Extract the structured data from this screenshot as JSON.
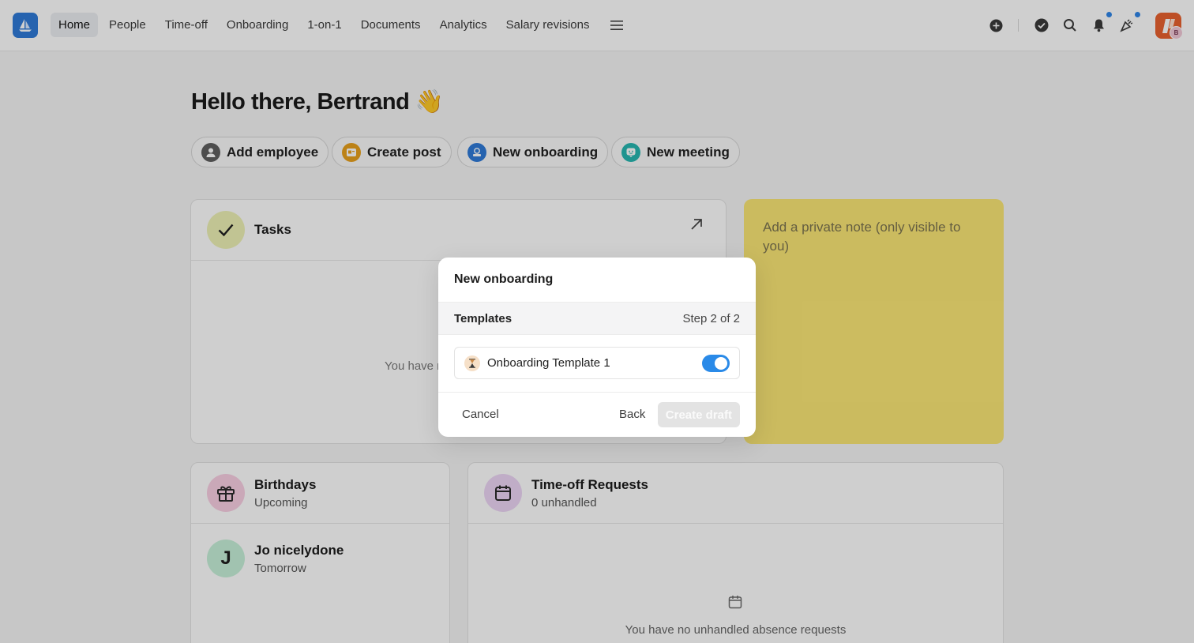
{
  "colors": {
    "accent": "#2a8ae8",
    "note_bg": "#fbe776",
    "overlay": "rgba(0,0,0,0.19)"
  },
  "topbar": {
    "logo_icon": "sailboat-icon",
    "nav": [
      "Home",
      "People",
      "Time-off",
      "Onboarding",
      "1-on-1",
      "Documents",
      "Analytics",
      "Salary revisions"
    ],
    "active": "Home",
    "icons": [
      "plus-circle-icon",
      "check-circle-icon",
      "search-icon",
      "bell-icon",
      "party-icon"
    ],
    "avatar_badge": "B"
  },
  "greeting": "Hello there, Bertrand 👋",
  "quick_actions": [
    {
      "label": "Add employee",
      "icon": "person-icon",
      "color": "#5f5f5f"
    },
    {
      "label": "Create post",
      "icon": "post-icon",
      "color": "#e8a11d"
    },
    {
      "label": "New onboarding",
      "icon": "onboarding-icon",
      "color": "#2f7bd8"
    },
    {
      "label": "New meeting",
      "icon": "chat-icon",
      "color": "#27b7b0"
    }
  ],
  "tasks": {
    "title": "Tasks",
    "empty_partial": "You have r"
  },
  "note": {
    "placeholder": "Add a private note (only visible to you)"
  },
  "birthdays": {
    "title": "Birthdays",
    "subtitle": "Upcoming",
    "person": "Jo nicelydone",
    "initial": "J",
    "when": "Tomorrow"
  },
  "timeoff": {
    "title": "Time-off Requests",
    "subtitle": "0 unhandled",
    "empty": "You have no unhandled absence requests"
  },
  "modal": {
    "title": "New onboarding",
    "section": "Templates",
    "step": "Step 2 of 2",
    "template_name": "Onboarding Template 1",
    "template_enabled": true,
    "cancel": "Cancel",
    "back": "Back",
    "create": "Create draft"
  }
}
